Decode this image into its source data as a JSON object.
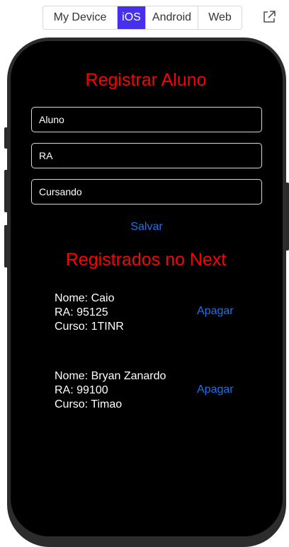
{
  "platform_tabs": {
    "items": [
      {
        "label": "My Device"
      },
      {
        "label": "iOS"
      },
      {
        "label": "Android"
      },
      {
        "label": "Web"
      }
    ],
    "selected": "iOS",
    "accent_color": "#4630eb"
  },
  "toolbar": {
    "external_link_icon": "external-link-icon"
  },
  "app": {
    "title": "Registrar Aluno",
    "title_color": "#ff0000",
    "fields": [
      {
        "placeholder": "Aluno"
      },
      {
        "placeholder": "RA"
      },
      {
        "placeholder": "Cursando"
      }
    ],
    "save_label": "Salvar",
    "link_color": "#1a73e8",
    "list_title": "Registrados no Next",
    "records": [
      {
        "nome": "Nome: Caio",
        "ra": "RA: 95125",
        "curso": "Curso: 1TINR",
        "delete_label": "Apagar"
      },
      {
        "nome": "Nome: Bryan Zanardo",
        "ra": "RA: 99100",
        "curso": "Curso: Timao",
        "delete_label": "Apagar"
      }
    ]
  }
}
